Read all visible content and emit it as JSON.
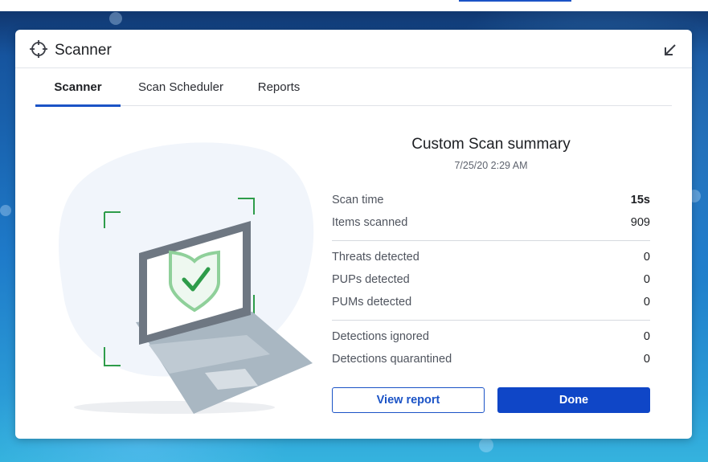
{
  "window": {
    "title": "Scanner"
  },
  "tabs": [
    {
      "label": "Scanner",
      "active": true
    },
    {
      "label": "Scan Scheduler",
      "active": false
    },
    {
      "label": "Reports",
      "active": false
    }
  ],
  "summary": {
    "title": "Custom Scan summary",
    "date": "7/25/20 2:29 AM",
    "stats": [
      {
        "label": "Scan time",
        "value": "15s"
      },
      {
        "label": "Items scanned",
        "value": "909"
      },
      {
        "label": "Threats detected",
        "value": "0"
      },
      {
        "label": "PUPs detected",
        "value": "0"
      },
      {
        "label": "PUMs detected",
        "value": "0"
      },
      {
        "label": "Detections ignored",
        "value": "0"
      },
      {
        "label": "Detections quarantined",
        "value": "0"
      }
    ]
  },
  "buttons": {
    "view_report": "View report",
    "done": "Done"
  },
  "icons": {
    "app": "crosshair-icon",
    "minimize": "arrow-down-left-icon",
    "illustration": "laptop-shield-check-icon"
  },
  "colors": {
    "accent": "#1b53c6",
    "primary_button": "#0f46c7",
    "shield_green": "#7fcf8f",
    "corner_green": "#2e9c4a"
  }
}
